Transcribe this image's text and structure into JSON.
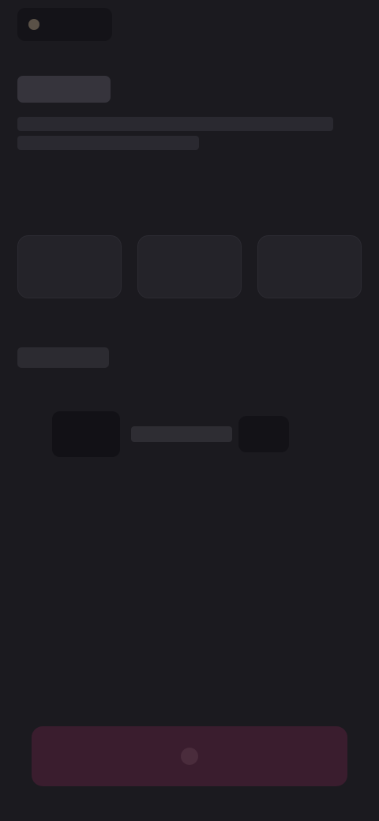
{
  "header": {
    "app_label": ""
  },
  "page": {
    "title": "",
    "description": ""
  },
  "options_section": {
    "label": "",
    "cards": [
      {
        "label": ""
      },
      {
        "label": ""
      },
      {
        "label": ""
      }
    ]
  },
  "list_section": {
    "heading": "",
    "items": [
      {
        "index": "",
        "subtitle": "",
        "title": "",
        "meta": "",
        "price": "",
        "remove_label": ""
      }
    ]
  },
  "primary_action": {
    "label": ""
  },
  "colors": {
    "background": "#1b1a1f",
    "card": "#242329",
    "accent": "#3a1d2e"
  }
}
